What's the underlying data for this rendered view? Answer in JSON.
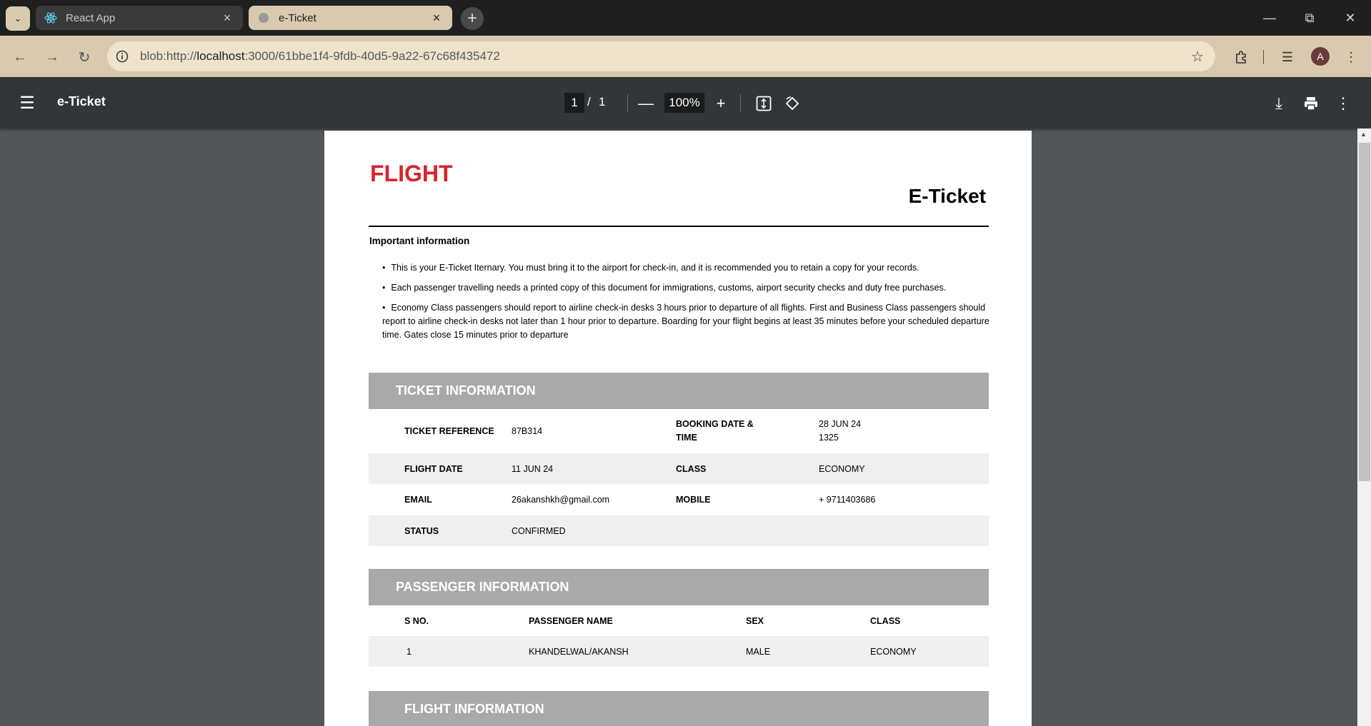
{
  "browser": {
    "tabs": [
      {
        "title": "React App",
        "active": false
      },
      {
        "title": "e-Ticket",
        "active": true
      }
    ],
    "url_prefix": "blob:http://",
    "url_host": "localhost",
    "url_rest": ":3000/61bbe1f4-9fdb-40d5-9a22-67c68f435472",
    "avatar_letter": "A"
  },
  "viewer": {
    "title": "e-Ticket",
    "page_current": "1",
    "page_separator": "/",
    "page_total": "1",
    "zoom": "100%"
  },
  "ticket": {
    "brand": "FLIGHT",
    "heading": "E-Ticket",
    "important_title": "Important information",
    "important_items": [
      "This is your E-Ticket Iternary. You must bring it to the airport for check-in, and it is recommended you to retain a copy for your records.",
      "Each passenger travelling needs a printed copy of this document for immigrations, customs, airport security checks and duty free purchases.",
      "Economy Class passengers should report to airline check-in desks 3 hours prior to departure of all flights. First and Business Class passengers should report to airline check-in desks not later than 1 hour prior to departure. Boarding for your flight begins at least 35 minutes before your scheduled departure time. Gates close 15 minutes prior to departure"
    ],
    "ticket_info": {
      "title": "TICKET INFORMATION",
      "rows": [
        {
          "l1": "TICKET REFERENCE",
          "v1": "87B314",
          "l2": "BOOKING DATE & TIME",
          "v2": "28 JUN 24 1325"
        },
        {
          "l1": "FLIGHT DATE",
          "v1": "11 JUN 24",
          "l2": "CLASS",
          "v2": "ECONOMY"
        },
        {
          "l1": "EMAIL",
          "v1": "26akanshkh@gmail.com",
          "l2": "MOBILE",
          "v2": "+ 9711403686"
        },
        {
          "l1": "STATUS",
          "v1": "CONFIRMED",
          "l2": "",
          "v2": ""
        }
      ]
    },
    "passenger_info": {
      "title": "PASSENGER INFORMATION",
      "headers": [
        "S NO.",
        "PASSENGER NAME",
        "SEX",
        "CLASS"
      ],
      "rows": [
        [
          "1",
          "KHANDELWAL/AKANSH",
          "MALE",
          "ECONOMY"
        ]
      ]
    },
    "flight_info": {
      "title": "FLIGHT INFORMATION"
    }
  },
  "colors": {
    "brand_red": "#d9232d",
    "section_gray": "#a9a9a9",
    "row_shade": "#efefef",
    "viewer_bg": "#525659",
    "viewer_bar": "#323639",
    "chrome_accent": "#d9c9ae"
  }
}
